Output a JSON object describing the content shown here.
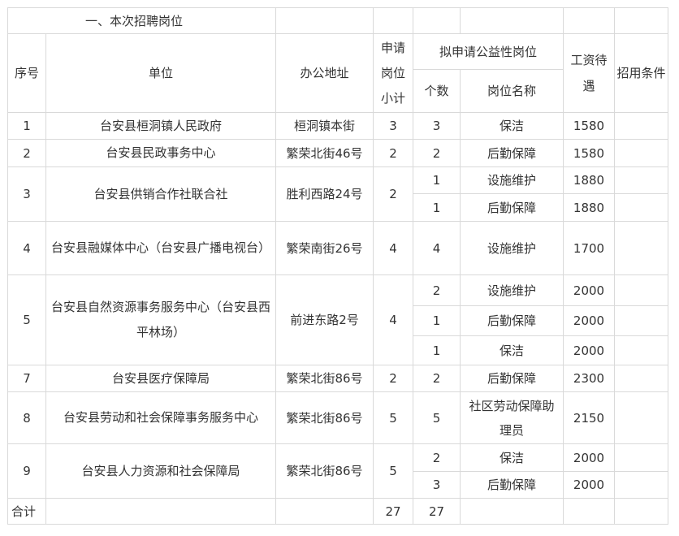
{
  "section_title": "一、本次招聘岗位",
  "headers": {
    "seq": "序号",
    "unit": "单位",
    "address": "办公地址",
    "subtotal": "申请岗位小计",
    "proposed": "拟申请公益性岗位",
    "count": "个数",
    "post_name": "岗位名称",
    "salary": "工资待遇",
    "conditions": "招用条件"
  },
  "rows": [
    {
      "seq": "1",
      "unit": "台安县桓洞镇人民政府",
      "address": "桓洞镇本街",
      "subtotal": "3",
      "posts": [
        {
          "count": "3",
          "name": "保洁",
          "salary": "1580",
          "cond": ""
        }
      ]
    },
    {
      "seq": "2",
      "unit": "台安县民政事务中心",
      "address": "繁荣北街46号",
      "subtotal": "2",
      "posts": [
        {
          "count": "2",
          "name": "后勤保障",
          "salary": "1580",
          "cond": ""
        }
      ]
    },
    {
      "seq": "3",
      "unit": "台安县供销合作社联合社",
      "address": "胜利西路24号",
      "subtotal": "2",
      "posts": [
        {
          "count": "1",
          "name": "设施维护",
          "salary": "1880",
          "cond": ""
        },
        {
          "count": "1",
          "name": "后勤保障",
          "salary": "1880",
          "cond": ""
        }
      ]
    },
    {
      "seq": "4",
      "unit": "台安县融媒体中心（台安县广播电视台）",
      "address": "繁荣南街26号",
      "subtotal": "4",
      "posts": [
        {
          "count": "4",
          "name": "设施维护",
          "salary": "1700",
          "cond": ""
        }
      ]
    },
    {
      "seq": "5",
      "unit": "台安县自然资源事务服务中心（台安县西平林场）",
      "address": "前进东路2号",
      "subtotal": "4",
      "posts": [
        {
          "count": "2",
          "name": "设施维护",
          "salary": "2000",
          "cond": ""
        },
        {
          "count": "1",
          "name": "后勤保障",
          "salary": "2000",
          "cond": ""
        },
        {
          "count": "1",
          "name": "保洁",
          "salary": "2000",
          "cond": ""
        }
      ]
    },
    {
      "seq": "7",
      "unit": "台安县医疗保障局",
      "address": "繁荣北街86号",
      "subtotal": "2",
      "posts": [
        {
          "count": "2",
          "name": "后勤保障",
          "salary": "2300",
          "cond": ""
        }
      ]
    },
    {
      "seq": "8",
      "unit": "台安县劳动和社会保障事务服务中心",
      "address": "繁荣北街86号",
      "subtotal": "5",
      "posts": [
        {
          "count": "5",
          "name": "社区劳动保障助理员",
          "salary": "2150",
          "cond": ""
        }
      ]
    },
    {
      "seq": "9",
      "unit": "台安县人力资源和社会保障局",
      "address": "繁荣北街86号",
      "subtotal": "5",
      "posts": [
        {
          "count": "2",
          "name": "保洁",
          "salary": "2000",
          "cond": ""
        },
        {
          "count": "3",
          "name": "后勤保障",
          "salary": "2000",
          "cond": ""
        }
      ]
    }
  ],
  "total": {
    "label": "合计",
    "subtotal": "27",
    "count": "27"
  }
}
